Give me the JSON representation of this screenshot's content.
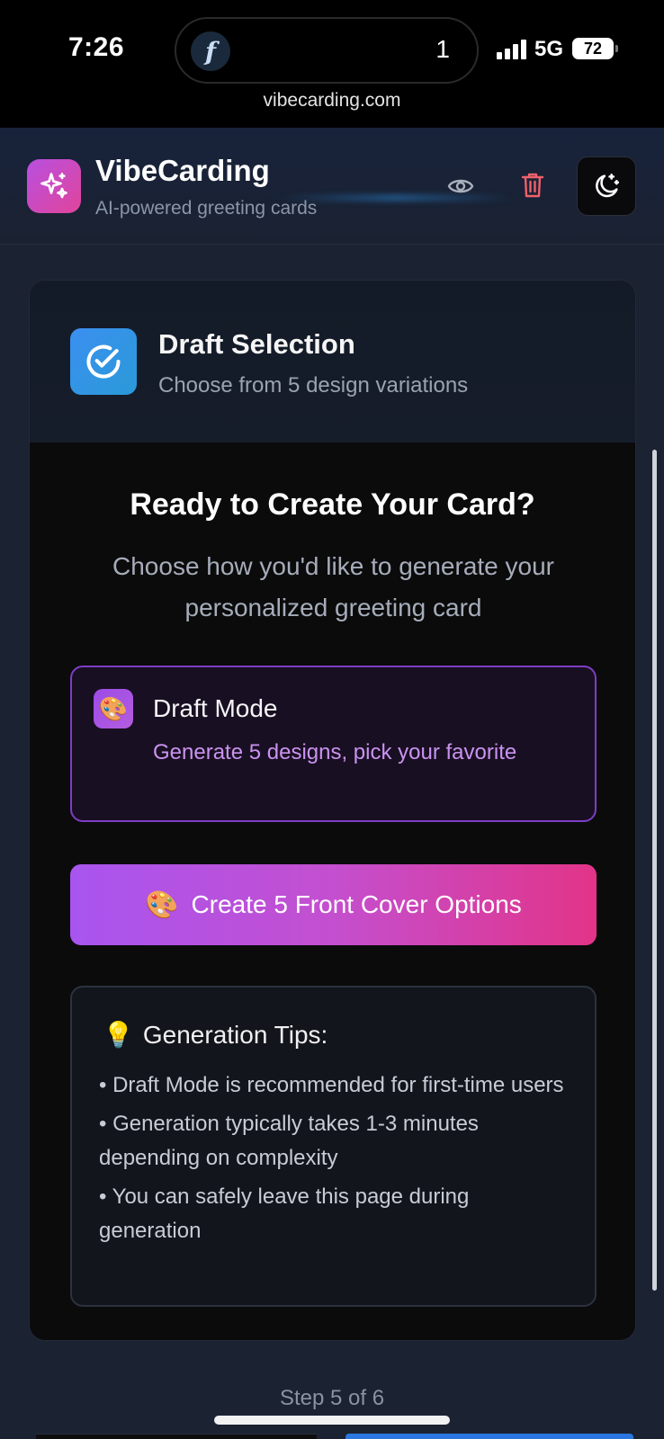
{
  "status_bar": {
    "time": "7:26",
    "island_count": "1",
    "network": "5G",
    "battery": "72",
    "url": "vibecarding.com"
  },
  "header": {
    "app_name": "VibeCarding",
    "tagline": "AI-powered greeting cards"
  },
  "step": {
    "title": "Draft Selection",
    "subtitle": "Choose from 5 design variations"
  },
  "main": {
    "heading": "Ready to Create Your Card?",
    "subheading": "Choose how you'd like to generate your personalized greeting card",
    "mode": {
      "title": "Draft Mode",
      "description": "Generate 5 designs, pick your favorite",
      "icon": "palette-icon"
    },
    "create_button": {
      "emoji": "🎨",
      "label": "Create 5 Front Cover Options"
    },
    "tips": {
      "emoji": "💡",
      "title": "Generation Tips:",
      "items": [
        "• Draft Mode is recommended for first-time users",
        "• Generation typically takes 1-3 minutes depending on complexity",
        "• You can safely leave this page during generation"
      ]
    }
  },
  "footer": {
    "step_indicator": "Step 5 of 6"
  },
  "colors": {
    "accent_purple": "#a855f0",
    "accent_pink": "#e23488",
    "step_blue": "#3b8ff0",
    "trash_red": "#f0616a"
  }
}
